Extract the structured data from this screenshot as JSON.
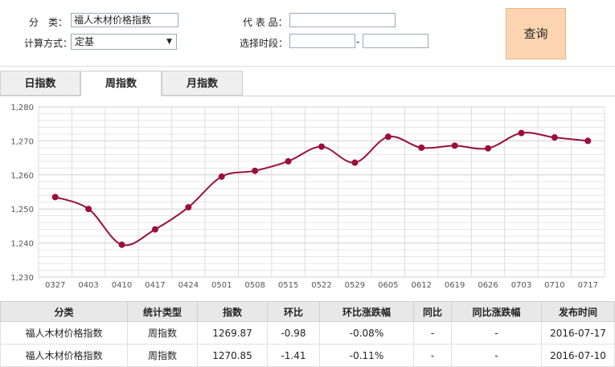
{
  "form": {
    "category_label": "分　类：",
    "category_value": "福人木材价格指数",
    "code_label": "代 表 品：",
    "code_value": "",
    "calc_label": "计算方式：",
    "calc_value": "定基",
    "period_label": "选择时段：",
    "period_from": "",
    "period_sep": "-",
    "period_to": "",
    "query_label": "查询"
  },
  "tabs": [
    {
      "label": "日指数",
      "active": false
    },
    {
      "label": "周指数",
      "active": true
    },
    {
      "label": "月指数",
      "active": false
    }
  ],
  "chart_data": {
    "type": "line",
    "categories": [
      "0327",
      "0403",
      "0410",
      "0417",
      "0424",
      "0501",
      "0508",
      "0515",
      "0522",
      "0529",
      "0605",
      "0612",
      "0619",
      "0626",
      "0703",
      "0710",
      "0717"
    ],
    "values": [
      1253.5,
      1250,
      1239.5,
      1244,
      1250.5,
      1259.5,
      1261.2,
      1264,
      1268.3,
      1263.6,
      1271.2,
      1268,
      1268.6,
      1267.8,
      1272.3,
      1271,
      1270
    ],
    "ylim": [
      1230,
      1280
    ],
    "yticks": [
      "1,230",
      "1,240",
      "1,250",
      "1,260",
      "1,270",
      "1,280"
    ],
    "grid": true,
    "line_color": "#9b0f3a"
  },
  "table": {
    "headers": [
      "分类",
      "统计类型",
      "指数",
      "环比",
      "环比涨跌幅",
      "同比",
      "同比涨跌幅",
      "发布时间"
    ],
    "rows": [
      [
        "福人木材价格指数",
        "周指数",
        "1269.87",
        "-0.98",
        "-0.08%",
        "-",
        "-",
        "2016-07-17"
      ],
      [
        "福人木材价格指数",
        "周指数",
        "1270.85",
        "-1.41",
        "-0.11%",
        "-",
        "-",
        "2016-07-10"
      ]
    ]
  }
}
